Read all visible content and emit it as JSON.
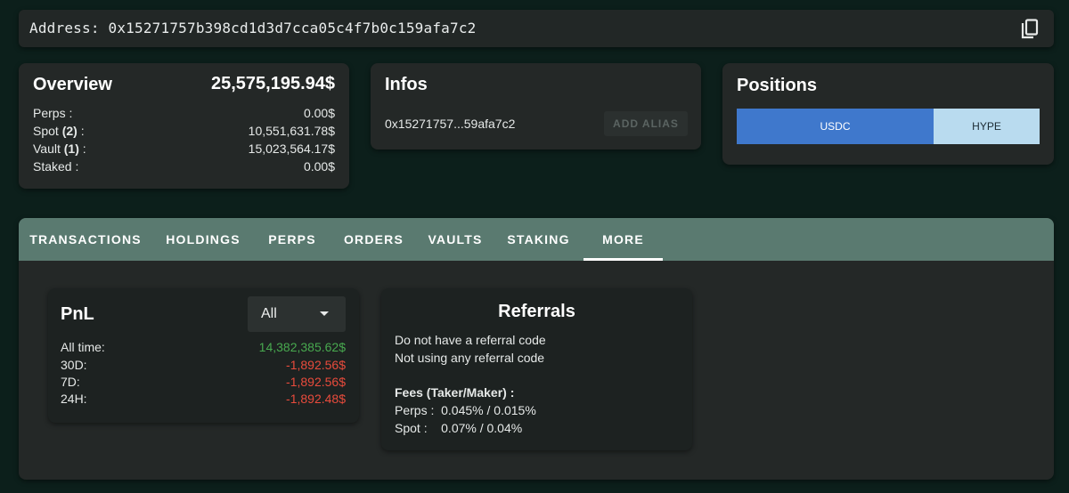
{
  "address_bar": {
    "label": "Address:",
    "address": "0x15271757b398cd1d3d7cca05c4f7b0c159afa7c2",
    "copy_icon": "copy-icon"
  },
  "overview": {
    "title": "Overview",
    "total": "25,575,195.94$",
    "rows": [
      {
        "label": "Perps :",
        "count": "",
        "value": "0.00$"
      },
      {
        "label": "Spot",
        "count": "(2)",
        "suffix": ":",
        "value": "10,551,631.78$"
      },
      {
        "label": "Vault",
        "count": "(1)",
        "suffix": ":",
        "value": "15,023,564.17$"
      },
      {
        "label": "Staked :",
        "count": "",
        "value": "0.00$"
      }
    ]
  },
  "infos": {
    "title": "Infos",
    "short_address": "0x15271757...59afa7c2",
    "add_alias_label": "ADD ALIAS"
  },
  "positions": {
    "title": "Positions",
    "options": [
      "USDC",
      "HYPE"
    ],
    "selected": "USDC"
  },
  "tabs": {
    "items": [
      "TRANSACTIONS",
      "HOLDINGS",
      "PERPS",
      "ORDERS",
      "VAULTS",
      "STAKING",
      "MORE"
    ],
    "active": "MORE"
  },
  "pnl": {
    "title": "PnL",
    "filter_value": "All",
    "rows": [
      {
        "label": "All time:",
        "value": "14,382,385.62$",
        "sign": "positive"
      },
      {
        "label": "30D:",
        "value": "-1,892.56$",
        "sign": "negative"
      },
      {
        "label": "7D:",
        "value": "-1,892.56$",
        "sign": "negative"
      },
      {
        "label": "24H:",
        "value": "-1,892.48$",
        "sign": "negative"
      }
    ]
  },
  "referrals": {
    "title": "Referrals",
    "line1": "Do not have a referral code",
    "line2": "Not using any referral code",
    "fees_heading": "Fees (Taker/Maker) :",
    "perps_line": "Perps :  0.045% / 0.015%",
    "spot_line": "Spot :    0.07% / 0.04%"
  },
  "colors": {
    "background": "#0c1f1b",
    "card": "#242827",
    "tab_bar": "#5a7a70",
    "positive": "#48a94f",
    "negative": "#e84b3c",
    "usdc_selected": "#3f78cc",
    "hype": "#b9dbef"
  }
}
